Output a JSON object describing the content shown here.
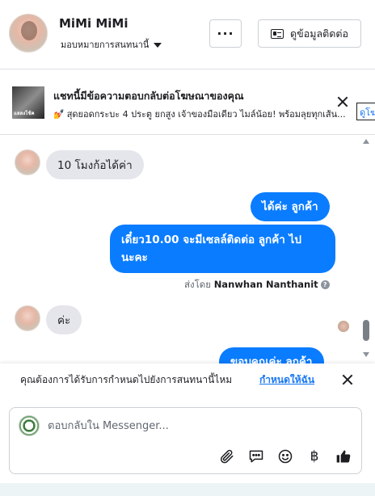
{
  "header": {
    "contact_name": "MiMi MiMi",
    "assign_label": "มอบหมายการสนทนานี้",
    "more_label": "···",
    "contact_info_label": "ดูข้อมูลติดต่อ"
  },
  "ad_banner": {
    "thumb_label": "แลลงโช้ค",
    "title": "แชทนี้มีข้อความตอบกลับต่อโฆษณาของคุณ",
    "subtitle": "สุดยอดกระบะ 4 ประตู ยกสูง เจ้าของมือเดียว ไมล์น้อย! พร้อมลุยทุกเส้น...",
    "subtitle_emoji": "💅",
    "view_button": "ดูโฆษณา"
  },
  "messages": {
    "incoming_1": "10 โมงก้อได้ค่า",
    "outgoing_1": "ได้ค่ะ  ลูกค้า",
    "outgoing_2_line1": "เดี๋ยว10.00 จะมีเซลล์ติดต่อ ลูกค้า ไป",
    "outgoing_2_line2": "นะคะ",
    "sent_by_prefix": "ส่งโดย",
    "sent_by_name": "Nanwhan Nanthanit",
    "info_glyph": "?",
    "incoming_2": "ค่ะ",
    "outgoing_3_partial": "ขอบคุณค่ะ ลูกค้า"
  },
  "assign_prompt": {
    "text": "คุณต้องการได้รับการกำหนดไปยังการสนทนานี้ไหม",
    "link": "กำหนดให้ฉัน"
  },
  "composer": {
    "placeholder": "ตอบกลับใน Messenger...",
    "baht_glyph": "฿"
  },
  "colors": {
    "outgoing_bubble": "#0a7cff",
    "incoming_bubble": "#e4e6eb",
    "link": "#1877f2"
  },
  "icons": [
    "more-icon",
    "contact-card-icon",
    "caret-down-icon",
    "close-icon",
    "attachment-icon",
    "saved-reply-icon",
    "emoji-icon",
    "baht-icon",
    "like-icon"
  ]
}
